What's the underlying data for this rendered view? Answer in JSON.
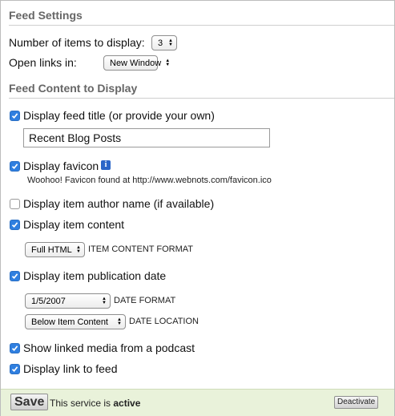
{
  "feed_settings": {
    "title": "Feed Settings",
    "items_label": "Number of items to display:",
    "items_value": "3",
    "open_links_label": "Open links in:",
    "open_links_value": "New Window"
  },
  "content": {
    "title": "Feed Content to Display",
    "display_title": {
      "label": "Display feed title (or provide your own)",
      "checked": true,
      "value": "Recent Blog Posts"
    },
    "display_favicon": {
      "label": "Display favicon",
      "checked": true,
      "note": "Woohoo! Favicon found at http://www.webnots.com/favicon.ico",
      "info_icon": "info-icon"
    },
    "author": {
      "label": "Display item author name (if available)",
      "checked": false
    },
    "item_content": {
      "label": "Display item content",
      "checked": true,
      "format_value": "Full HTML",
      "format_caption": "ITEM CONTENT FORMAT"
    },
    "pub_date": {
      "label": "Display item publication date",
      "checked": true,
      "date_format_value": "1/5/2007",
      "date_format_caption": "DATE FORMAT",
      "date_location_value": "Below Item Content",
      "date_location_caption": "DATE LOCATION"
    },
    "podcast": {
      "label": "Show linked media from a podcast",
      "checked": true
    },
    "link_to_feed": {
      "label": "Display link to feed",
      "checked": true
    }
  },
  "footer": {
    "save_label": "Save",
    "status_prefix": "This service is",
    "status_value": "active",
    "deactivate_label": "Deactivate"
  },
  "colors": {
    "checkbox_on": "#2f7fe0",
    "footer_bg": "#e9f2da",
    "info_icon": "#2b66c8"
  }
}
